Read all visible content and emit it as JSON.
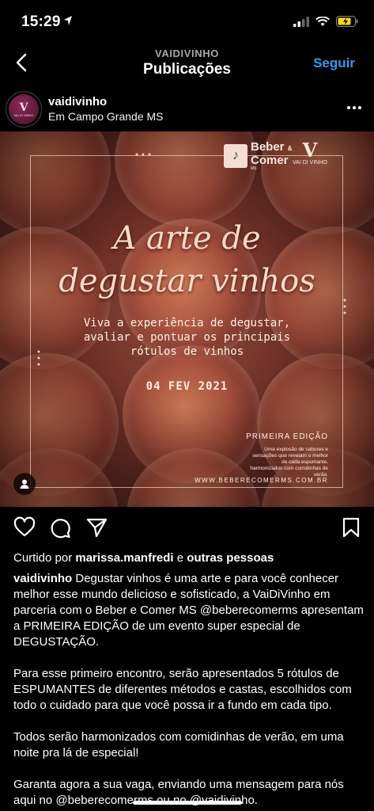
{
  "status": {
    "time": "15:29"
  },
  "nav": {
    "subtitle": "VAIDIVINHO",
    "title": "Publicações",
    "follow_label": "Seguir"
  },
  "post": {
    "username": "vaidivinho",
    "location": "Em Campo Grande MS",
    "avatar_text": "VAI DI VINHO"
  },
  "image": {
    "brand_name_1": "Beber",
    "brand_amp": "&",
    "brand_name_2": "Comer",
    "brand_small": "MS",
    "brand2": "VAI DI VINHO",
    "headline_1": "A arte de",
    "headline_2": "degustar vinhos",
    "sub_1": "Viva a experiência de degustar,",
    "sub_2": "avaliar e pontuar os principais",
    "sub_3": "rótulos de vinhos",
    "date": "04 FEV 2021",
    "edition": "PRIMEIRA EDIÇÃO",
    "edition_desc": "Uma explosão de sabores e sensações que revelam o melhor de cada espumante, harmonizados com comidinhas de verão.",
    "site": "WWW.BEBERECOMERMS.COM.BR"
  },
  "likes": {
    "prefix": "Curtido por",
    "user": "marissa.manfredi",
    "mid": "e",
    "others": "outras pessoas"
  },
  "caption": {
    "username": "vaidivinho",
    "p1": "Degustar vinhos é uma arte e para você conhecer melhor esse mundo delicioso e sofisticado, a VaiDiVinho em parceria com o Beber e Comer MS @beberecomerms apresentam a PRIMEIRA EDIÇÃO de um evento super especial de DEGUSTAÇÃO.",
    "p2": "Para esse primeiro encontro, serão apresentados 5 rótulos de ESPUMANTES de diferentes métodos e castas, escolhidos com todo o cuidado para que você possa ir a fundo em cada tipo.",
    "p3": "Todos serão harmonizados com comidinhas de verão, em uma noite pra lá de especial!",
    "p4": "Garanta agora a sua vaga, enviando uma mensagem para nós aqui no @beberecomerms ou no @vaidivinho."
  },
  "colors": {
    "accent": "#3897f0",
    "background": "#000000"
  },
  "icons": [
    "location-arrow-icon",
    "signal-icon",
    "wifi-icon",
    "battery-icon",
    "back-chevron-icon",
    "more-icon",
    "heart-icon",
    "comment-icon",
    "share-icon",
    "bookmark-icon",
    "user-tag-icon"
  ]
}
